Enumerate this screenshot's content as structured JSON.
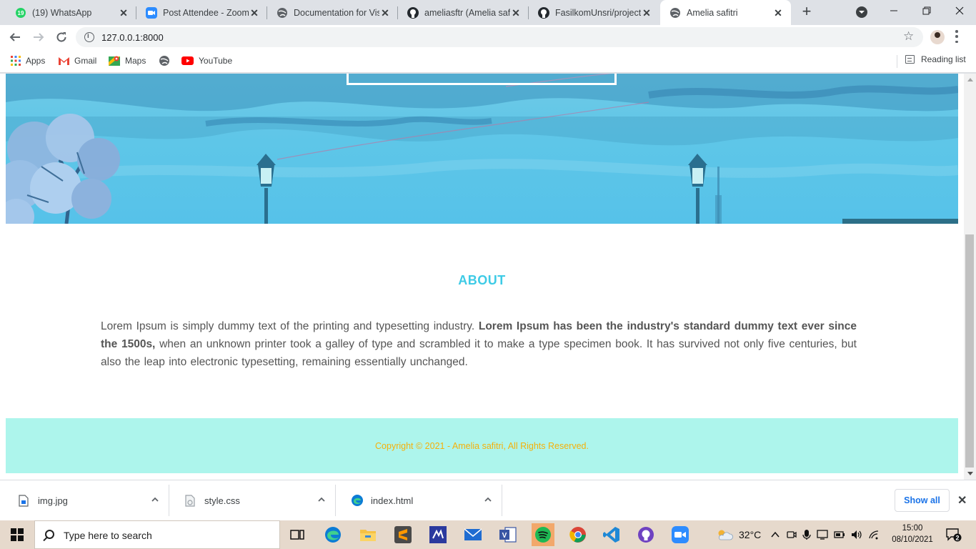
{
  "browser": {
    "tabs": [
      {
        "title": "(19) WhatsApp",
        "badge": "19",
        "icon": "whatsapp-icon",
        "active": false
      },
      {
        "title": "Post Attendee - Zoom",
        "icon": "zoom-icon",
        "active": false
      },
      {
        "title": "Documentation for Vis",
        "icon": "globe-icon",
        "active": false
      },
      {
        "title": "ameliasftr (Amelia safi",
        "icon": "github-icon",
        "active": false
      },
      {
        "title": "FasilkomUnsri/project-",
        "icon": "github-icon",
        "active": false
      },
      {
        "title": "Amelia safitri",
        "icon": "globe-icon",
        "active": true
      }
    ],
    "close_glyph": "✕",
    "new_tab_glyph": "+",
    "address": "127.0.0.1:8000",
    "bookmarks": [
      {
        "label": "Apps",
        "icon": "apps-grid-icon"
      },
      {
        "label": "Gmail",
        "icon": "gmail-icon"
      },
      {
        "label": "Maps",
        "icon": "maps-icon"
      },
      {
        "label": "",
        "icon": "globe-icon"
      },
      {
        "label": "YouTube",
        "icon": "youtube-icon"
      }
    ],
    "reading_list": "Reading list"
  },
  "page": {
    "about_heading": "ABOUT",
    "about_text_1": "Lorem Ipsum is simply dummy text of the printing and typesetting industry. ",
    "about_text_bold": "Lorem Ipsum has been the industry's standard dummy text ever since the 1500s,",
    "about_text_2": " when an unknown printer took a galley of type and scrambled it to make a type specimen book. It has survived not only five centuries, but also the leap into electronic typesetting, remaining essentially unchanged.",
    "copyright": "Copyright © 2021 - Amelia safitri, All Rights Reserved.",
    "colors": {
      "heading": "#3ecbe6",
      "footer_bg": "#adf5ec",
      "copyright": "#f5b10a",
      "hero_sky": "#5ec6e8"
    }
  },
  "downloads": {
    "items": [
      {
        "name": "img.jpg",
        "icon": "file-icon"
      },
      {
        "name": "style.css",
        "icon": "css-file-icon"
      },
      {
        "name": "index.html",
        "icon": "edge-icon"
      }
    ],
    "show_all": "Show all"
  },
  "taskbar": {
    "search_placeholder": "Type here to search",
    "apps": [
      "task-view-icon",
      "edge-icon",
      "file-explorer-icon",
      "sublime-text-icon",
      "visual-studio-icon",
      "mail-icon",
      "visio-icon",
      "spotify-icon",
      "chrome-icon",
      "vscode-icon",
      "github-desktop-icon",
      "zoom-icon"
    ],
    "weather": "32°C",
    "time": "15:00",
    "date": "08/10/2021",
    "notifications": "2"
  }
}
